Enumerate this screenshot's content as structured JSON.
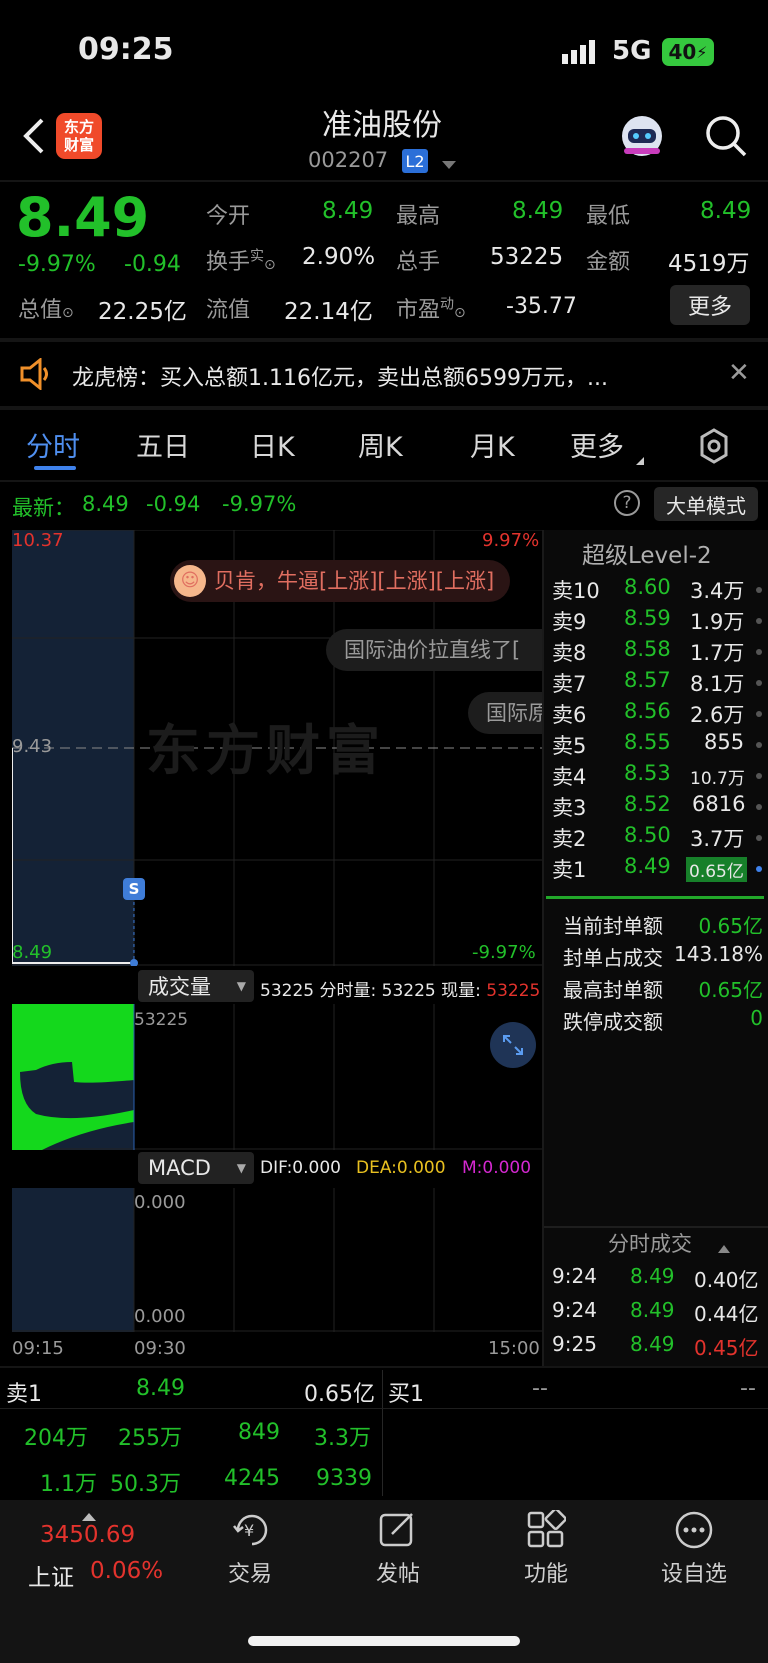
{
  "status": {
    "time": "09:25",
    "network": "5G",
    "battery": "40"
  },
  "header": {
    "title": "准油股份",
    "code": "002207",
    "badge": "L2",
    "logo_line1": "东方",
    "logo_line2": "财富"
  },
  "quote": {
    "price": "8.49",
    "pct": "-9.97%",
    "change": "-0.94",
    "l_open": "今开",
    "v_open": "8.49",
    "l_high": "最高",
    "v_high": "8.49",
    "l_low": "最低",
    "v_low": "8.49",
    "l_turn": "换手",
    "turn_sup": "实",
    "v_turn": "2.90%",
    "l_vol": "总手",
    "v_vol": "53225",
    "l_amt": "金额",
    "v_amt": "4519万",
    "l_mcap": "总值",
    "v_mcap": "22.25亿",
    "l_float": "流值",
    "v_float": "22.14亿",
    "l_pe": "市盈",
    "pe_sup": "动",
    "v_pe": "-35.77",
    "more": "更多"
  },
  "notice": {
    "text": "龙虎榜：买入总额1.116亿元，卖出总额6599万元，..."
  },
  "tabs": [
    "分时",
    "五日",
    "日K",
    "周K",
    "月K",
    "更多"
  ],
  "chart_bar": {
    "latest_label": "最新：",
    "latest_price": "8.49",
    "latest_change": "-0.94",
    "latest_pct": "-9.97%",
    "mode": "大单模式"
  },
  "chart": {
    "y_top": "10.37",
    "y_mid": "9.43",
    "y_bot": "8.49",
    "pct_top": "9.97%",
    "pct_bot": "-9.97%",
    "watermark": "东方财富",
    "s_marker": "S",
    "danmaku": [
      "贝肯，牛逼[上涨][上涨][上涨]",
      "国际油价拉直线了[",
      "国际原"
    ],
    "x_labels": [
      "09:15",
      "09:30",
      "15:00"
    ]
  },
  "volume": {
    "label": "成交量",
    "info_a": "53225",
    "info_b_label": "分时量:",
    "info_b": "53225",
    "info_c_label": "现量:",
    "info_c": "53225",
    "max": "53225"
  },
  "macd": {
    "label": "MACD",
    "dif": "DIF:0.000",
    "dea": "DEA:0.000",
    "m": "M:0.000",
    "top": "0.000",
    "bot": "0.000"
  },
  "level2": {
    "title": "超级Level-2",
    "asks": [
      [
        "卖10",
        "8.60",
        "3.4万"
      ],
      [
        "卖9",
        "8.59",
        "1.9万"
      ],
      [
        "卖8",
        "8.58",
        "1.7万"
      ],
      [
        "卖7",
        "8.57",
        "8.1万"
      ],
      [
        "卖6",
        "8.56",
        "2.6万"
      ],
      [
        "卖5",
        "8.55",
        "855"
      ],
      [
        "卖4",
        "8.53",
        "10.7万"
      ],
      [
        "卖3",
        "8.52",
        "6816"
      ],
      [
        "卖2",
        "8.50",
        "3.7万"
      ],
      [
        "卖1",
        "8.49",
        "0.65亿"
      ]
    ],
    "stats": [
      [
        "当前封单额",
        "0.65亿"
      ],
      [
        "封单占成交",
        "143.18%"
      ],
      [
        "最高封单额",
        "0.65亿"
      ],
      [
        "跌停成交额",
        "0"
      ]
    ]
  },
  "ticks": {
    "title": "分时成交",
    "rows": [
      [
        "9:24",
        "8.49",
        "0.40亿"
      ],
      [
        "9:24",
        "8.49",
        "0.44亿"
      ],
      [
        "9:25",
        "8.49",
        "0.45亿"
      ]
    ]
  },
  "bottom": {
    "sell_label": "卖1",
    "sell_price": "8.49",
    "sell_amt": "0.65亿",
    "buy_label": "买1",
    "buy_price": "--",
    "buy_amt": "--",
    "row1": [
      "204万",
      "255万",
      "849",
      "3.3万"
    ],
    "row2": [
      "1.1万",
      "50.3万",
      "4245",
      "9339"
    ]
  },
  "nav": {
    "index_value": "3450.69",
    "index_name": "上证",
    "index_pct": "0.06%",
    "items": [
      "交易",
      "发帖",
      "功能",
      "设自选"
    ]
  }
}
